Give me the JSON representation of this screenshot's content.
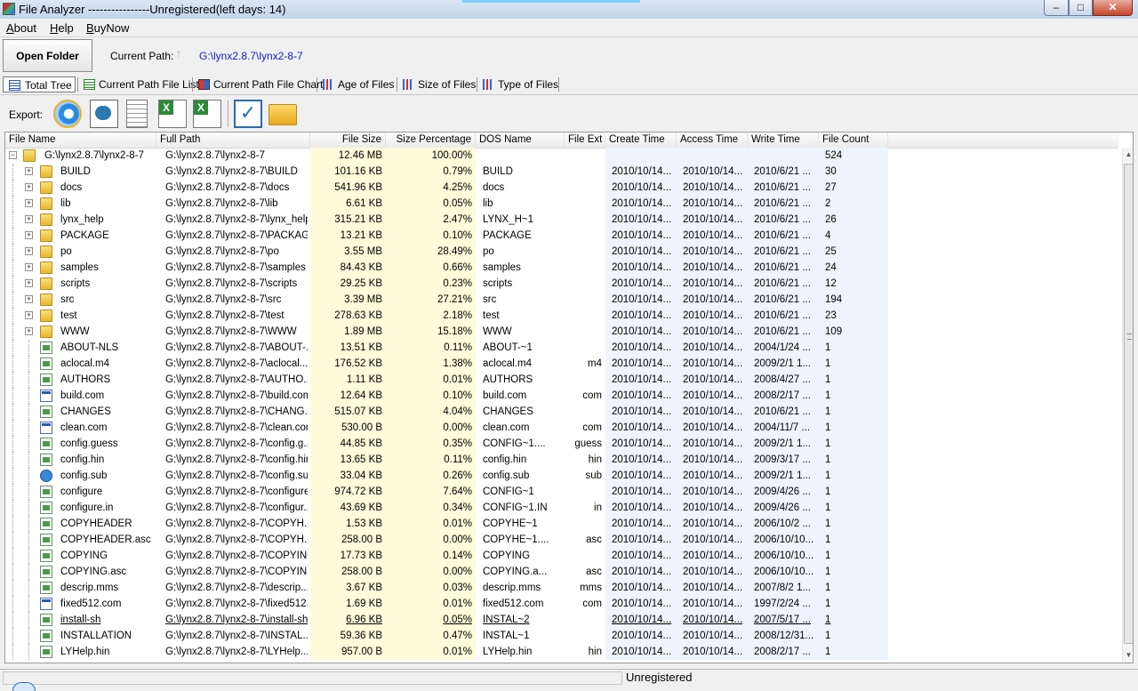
{
  "window": {
    "title": "File Analyzer ----------------Unregistered(left days: 14)",
    "min": "–",
    "max": "□",
    "close": "✕"
  },
  "menu": {
    "about": {
      "hot": "A",
      "rest": "bout"
    },
    "help": {
      "hot": "H",
      "rest": "elp"
    },
    "buynow": {
      "hot": "B",
      "rest": "uyNow"
    }
  },
  "toolbar": {
    "open_folder": "Open Folder",
    "current_path_label": "Current Path:",
    "up_icon": "↑",
    "current_path": "G:\\lynx2.8.7\\lynx2-8-7"
  },
  "tabs": [
    "Total Tree",
    "Current Path File List",
    "Current Path File Chart",
    "Age of Files",
    "Size of Files",
    "Type of Files"
  ],
  "export": {
    "label": "Export:",
    "icons": [
      "ie-icon",
      "html-icon",
      "text-icon",
      "excel-csv-icon",
      "excel-icon",
      "check-icon",
      "folder-open-icon"
    ]
  },
  "columns": [
    "File Name",
    "Full Path",
    "File Size",
    "Size Percentage",
    "DOS Name",
    "File Ext",
    "Create Time",
    "Access Time",
    "Write Time",
    "File Count"
  ],
  "rows": [
    {
      "type": "root",
      "name": "G:\\lynx2.8.7\\lynx2-8-7",
      "path": "G:\\lynx2.8.7\\lynx2-8-7",
      "size": "12.46 MB",
      "pct": "100.00%",
      "dos": "",
      "ext": "",
      "create": "",
      "access": "",
      "write": "",
      "count": "524"
    },
    {
      "type": "folder",
      "name": "BUILD",
      "path": "G:\\lynx2.8.7\\lynx2-8-7\\BUILD",
      "size": "101.16 KB",
      "pct": "0.79%",
      "dos": "BUILD",
      "ext": "",
      "create": "2010/10/14...",
      "access": "2010/10/14...",
      "write": "2010/6/21 ...",
      "count": "30"
    },
    {
      "type": "folder",
      "name": "docs",
      "path": "G:\\lynx2.8.7\\lynx2-8-7\\docs",
      "size": "541.96 KB",
      "pct": "4.25%",
      "dos": "docs",
      "ext": "",
      "create": "2010/10/14...",
      "access": "2010/10/14...",
      "write": "2010/6/21 ...",
      "count": "27"
    },
    {
      "type": "folder",
      "name": "lib",
      "path": "G:\\lynx2.8.7\\lynx2-8-7\\lib",
      "size": "6.61 KB",
      "pct": "0.05%",
      "dos": "lib",
      "ext": "",
      "create": "2010/10/14...",
      "access": "2010/10/14...",
      "write": "2010/6/21 ...",
      "count": "2"
    },
    {
      "type": "folder",
      "name": "lynx_help",
      "path": "G:\\lynx2.8.7\\lynx2-8-7\\lynx_help",
      "size": "315.21 KB",
      "pct": "2.47%",
      "dos": "LYNX_H~1",
      "ext": "",
      "create": "2010/10/14...",
      "access": "2010/10/14...",
      "write": "2010/6/21 ...",
      "count": "26"
    },
    {
      "type": "folder",
      "name": "PACKAGE",
      "path": "G:\\lynx2.8.7\\lynx2-8-7\\PACKAGE",
      "size": "13.21 KB",
      "pct": "0.10%",
      "dos": "PACKAGE",
      "ext": "",
      "create": "2010/10/14...",
      "access": "2010/10/14...",
      "write": "2010/6/21 ...",
      "count": "4"
    },
    {
      "type": "folder",
      "name": "po",
      "path": "G:\\lynx2.8.7\\lynx2-8-7\\po",
      "size": "3.55 MB",
      "pct": "28.49%",
      "dos": "po",
      "ext": "",
      "create": "2010/10/14...",
      "access": "2010/10/14...",
      "write": "2010/6/21 ...",
      "count": "25"
    },
    {
      "type": "folder",
      "name": "samples",
      "path": "G:\\lynx2.8.7\\lynx2-8-7\\samples",
      "size": "84.43 KB",
      "pct": "0.66%",
      "dos": "samples",
      "ext": "",
      "create": "2010/10/14...",
      "access": "2010/10/14...",
      "write": "2010/6/21 ...",
      "count": "24"
    },
    {
      "type": "folder",
      "name": "scripts",
      "path": "G:\\lynx2.8.7\\lynx2-8-7\\scripts",
      "size": "29.25 KB",
      "pct": "0.23%",
      "dos": "scripts",
      "ext": "",
      "create": "2010/10/14...",
      "access": "2010/10/14...",
      "write": "2010/6/21 ...",
      "count": "12"
    },
    {
      "type": "folder",
      "name": "src",
      "path": "G:\\lynx2.8.7\\lynx2-8-7\\src",
      "size": "3.39 MB",
      "pct": "27.21%",
      "dos": "src",
      "ext": "",
      "create": "2010/10/14...",
      "access": "2010/10/14...",
      "write": "2010/6/21 ...",
      "count": "194"
    },
    {
      "type": "folder",
      "name": "test",
      "path": "G:\\lynx2.8.7\\lynx2-8-7\\test",
      "size": "278.63 KB",
      "pct": "2.18%",
      "dos": "test",
      "ext": "",
      "create": "2010/10/14...",
      "access": "2010/10/14...",
      "write": "2010/6/21 ...",
      "count": "23"
    },
    {
      "type": "folder",
      "name": "WWW",
      "path": "G:\\lynx2.8.7\\lynx2-8-7\\WWW",
      "size": "1.89 MB",
      "pct": "15.18%",
      "dos": "WWW",
      "ext": "",
      "create": "2010/10/14...",
      "access": "2010/10/14...",
      "write": "2010/6/21 ...",
      "count": "109"
    },
    {
      "type": "file",
      "name": "ABOUT-NLS",
      "path": "G:\\lynx2.8.7\\lynx2-8-7\\ABOUT-...",
      "size": "13.51 KB",
      "pct": "0.11%",
      "dos": "ABOUT-~1",
      "ext": "",
      "create": "2010/10/14...",
      "access": "2010/10/14...",
      "write": "2004/1/24 ...",
      "count": "1"
    },
    {
      "type": "file",
      "name": "aclocal.m4",
      "path": "G:\\lynx2.8.7\\lynx2-8-7\\aclocal...",
      "size": "176.52 KB",
      "pct": "1.38%",
      "dos": "aclocal.m4",
      "ext": "m4",
      "create": "2010/10/14...",
      "access": "2010/10/14...",
      "write": "2009/2/1 1...",
      "count": "1"
    },
    {
      "type": "file",
      "name": "AUTHORS",
      "path": "G:\\lynx2.8.7\\lynx2-8-7\\AUTHO...",
      "size": "1.11 KB",
      "pct": "0.01%",
      "dos": "AUTHORS",
      "ext": "",
      "create": "2010/10/14...",
      "access": "2010/10/14...",
      "write": "2008/4/27 ...",
      "count": "1"
    },
    {
      "type": "com",
      "name": "build.com",
      "path": "G:\\lynx2.8.7\\lynx2-8-7\\build.com",
      "size": "12.64 KB",
      "pct": "0.10%",
      "dos": "build.com",
      "ext": "com",
      "create": "2010/10/14...",
      "access": "2010/10/14...",
      "write": "2008/2/17 ...",
      "count": "1"
    },
    {
      "type": "file",
      "name": "CHANGES",
      "path": "G:\\lynx2.8.7\\lynx2-8-7\\CHANG...",
      "size": "515.07 KB",
      "pct": "4.04%",
      "dos": "CHANGES",
      "ext": "",
      "create": "2010/10/14...",
      "access": "2010/10/14...",
      "write": "2010/6/21 ...",
      "count": "1"
    },
    {
      "type": "com",
      "name": "clean.com",
      "path": "G:\\lynx2.8.7\\lynx2-8-7\\clean.com",
      "size": "530.00 B",
      "pct": "0.00%",
      "dos": "clean.com",
      "ext": "com",
      "create": "2010/10/14...",
      "access": "2010/10/14...",
      "write": "2004/11/7 ...",
      "count": "1"
    },
    {
      "type": "file",
      "name": "config.guess",
      "path": "G:\\lynx2.8.7\\lynx2-8-7\\config.g...",
      "size": "44.85 KB",
      "pct": "0.35%",
      "dos": "CONFIG~1....",
      "ext": "guess",
      "create": "2010/10/14...",
      "access": "2010/10/14...",
      "write": "2009/2/1 1...",
      "count": "1"
    },
    {
      "type": "file",
      "name": "config.hin",
      "path": "G:\\lynx2.8.7\\lynx2-8-7\\config.hin",
      "size": "13.65 KB",
      "pct": "0.11%",
      "dos": "config.hin",
      "ext": "hin",
      "create": "2010/10/14...",
      "access": "2010/10/14...",
      "write": "2009/3/17 ...",
      "count": "1"
    },
    {
      "type": "sub",
      "name": "config.sub",
      "path": "G:\\lynx2.8.7\\lynx2-8-7\\config.sub",
      "size": "33.04 KB",
      "pct": "0.26%",
      "dos": "config.sub",
      "ext": "sub",
      "create": "2010/10/14...",
      "access": "2010/10/14...",
      "write": "2009/2/1 1...",
      "count": "1"
    },
    {
      "type": "file",
      "name": "configure",
      "path": "G:\\lynx2.8.7\\lynx2-8-7\\configure",
      "size": "974.72 KB",
      "pct": "7.64%",
      "dos": "CONFIG~1",
      "ext": "",
      "create": "2010/10/14...",
      "access": "2010/10/14...",
      "write": "2009/4/26 ...",
      "count": "1"
    },
    {
      "type": "file",
      "name": "configure.in",
      "path": "G:\\lynx2.8.7\\lynx2-8-7\\configur...",
      "size": "43.69 KB",
      "pct": "0.34%",
      "dos": "CONFIG~1.IN",
      "ext": "in",
      "create": "2010/10/14...",
      "access": "2010/10/14...",
      "write": "2009/4/26 ...",
      "count": "1"
    },
    {
      "type": "file",
      "name": "COPYHEADER",
      "path": "G:\\lynx2.8.7\\lynx2-8-7\\COPYH...",
      "size": "1.53 KB",
      "pct": "0.01%",
      "dos": "COPYHE~1",
      "ext": "",
      "create": "2010/10/14...",
      "access": "2010/10/14...",
      "write": "2006/10/2 ...",
      "count": "1"
    },
    {
      "type": "file",
      "name": "COPYHEADER.asc",
      "path": "G:\\lynx2.8.7\\lynx2-8-7\\COPYH...",
      "size": "258.00 B",
      "pct": "0.00%",
      "dos": "COPYHE~1....",
      "ext": "asc",
      "create": "2010/10/14...",
      "access": "2010/10/14...",
      "write": "2006/10/10...",
      "count": "1"
    },
    {
      "type": "file",
      "name": "COPYING",
      "path": "G:\\lynx2.8.7\\lynx2-8-7\\COPYING",
      "size": "17.73 KB",
      "pct": "0.14%",
      "dos": "COPYING",
      "ext": "",
      "create": "2010/10/14...",
      "access": "2010/10/14...",
      "write": "2006/10/10...",
      "count": "1"
    },
    {
      "type": "file",
      "name": "COPYING.asc",
      "path": "G:\\lynx2.8.7\\lynx2-8-7\\COPYIN...",
      "size": "258.00 B",
      "pct": "0.00%",
      "dos": "COPYING.a...",
      "ext": "asc",
      "create": "2010/10/14...",
      "access": "2010/10/14...",
      "write": "2006/10/10...",
      "count": "1"
    },
    {
      "type": "file",
      "name": "descrip.mms",
      "path": "G:\\lynx2.8.7\\lynx2-8-7\\descrip...",
      "size": "3.67 KB",
      "pct": "0.03%",
      "dos": "descrip.mms",
      "ext": "mms",
      "create": "2010/10/14...",
      "access": "2010/10/14...",
      "write": "2007/8/2 1...",
      "count": "1"
    },
    {
      "type": "com",
      "name": "fixed512.com",
      "path": "G:\\lynx2.8.7\\lynx2-8-7\\fixed512...",
      "size": "1.69 KB",
      "pct": "0.01%",
      "dos": "fixed512.com",
      "ext": "com",
      "create": "2010/10/14...",
      "access": "2010/10/14...",
      "write": "1997/2/24 ...",
      "count": "1"
    },
    {
      "type": "file",
      "name": "install-sh",
      "path": "G:\\lynx2.8.7\\lynx2-8-7\\install-sh",
      "size": "6.96 KB",
      "pct": "0.05%",
      "dos": "INSTAL~2",
      "ext": "",
      "create": "2010/10/14...",
      "access": "2010/10/14...",
      "write": "2007/5/17 ...",
      "count": "1",
      "underline": true
    },
    {
      "type": "file",
      "name": "INSTALLATION",
      "path": "G:\\lynx2.8.7\\lynx2-8-7\\INSTAL...",
      "size": "59.36 KB",
      "pct": "0.47%",
      "dos": "INSTAL~1",
      "ext": "",
      "create": "2010/10/14...",
      "access": "2010/10/14...",
      "write": "2008/12/31...",
      "count": "1"
    },
    {
      "type": "file",
      "name": "LYHelp.hin",
      "path": "G:\\lynx2.8.7\\lynx2-8-7\\LYHelp...",
      "size": "957.00 B",
      "pct": "0.01%",
      "dos": "LYHelp.hin",
      "ext": "hin",
      "create": "2010/10/14...",
      "access": "2010/10/14...",
      "write": "2008/2/17 ...",
      "count": "1"
    }
  ],
  "scrollbar": {
    "up": "▲",
    "down": "▼"
  },
  "status": {
    "text": "Unregistered"
  },
  "colors": {
    "size_column_bg": "#fdfbd9",
    "dates_bg": "#eef4fd",
    "path_link": "#1a1ad0"
  }
}
